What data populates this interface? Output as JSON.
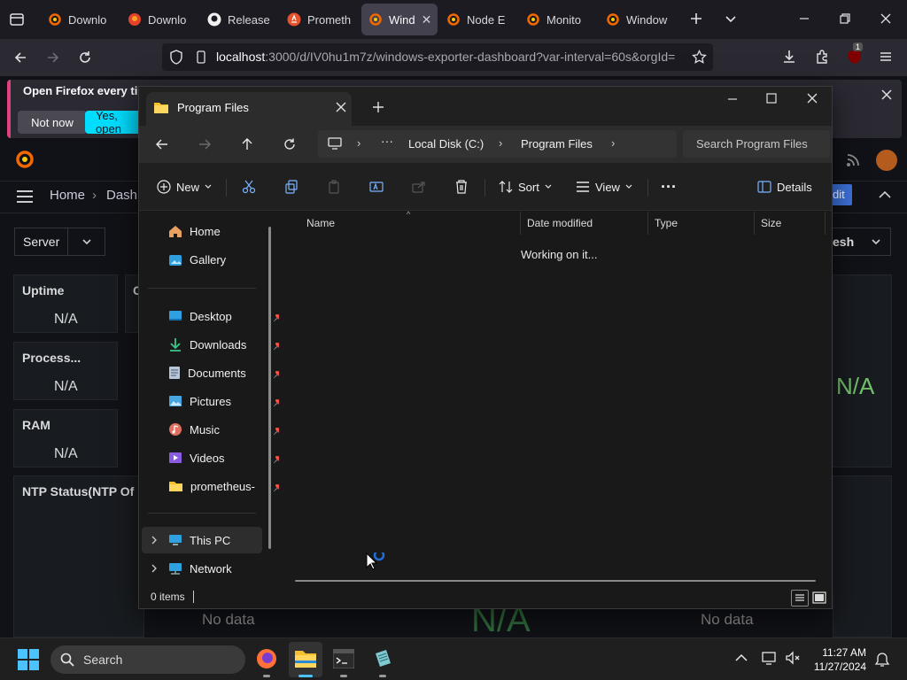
{
  "browser": {
    "tabs": [
      {
        "label": "Downlo",
        "icon": "grafana-icon",
        "active": false
      },
      {
        "label": "Downlo",
        "icon": "gitlab-icon",
        "active": false
      },
      {
        "label": "Release",
        "icon": "github-icon",
        "active": false
      },
      {
        "label": "Prometh",
        "icon": "prometheus-icon",
        "active": false
      },
      {
        "label": "Wind",
        "icon": "grafana-icon",
        "active": true
      },
      {
        "label": "Node E",
        "icon": "grafana-icon",
        "active": false
      },
      {
        "label": "Monito",
        "icon": "grafana-icon",
        "active": false
      },
      {
        "label": "Window",
        "icon": "grafana-icon",
        "active": false
      }
    ],
    "url_host": "localhost",
    "url_rest": ":3000/d/IV0hu1m7z/windows-exporter-dashboard?var-interval=60s&orgId=",
    "extension_badge": "1",
    "notification": {
      "text": "Open Firefox every time",
      "not_now": "Not now",
      "yes": "Yes, open"
    }
  },
  "grafana": {
    "breadcrumb_home": "Home",
    "breadcrumb_next": "Dashb",
    "server_label": "Server",
    "refresh_label": "esh",
    "edit_label": "dit",
    "panels": [
      {
        "title": "Uptime",
        "value": "N/A"
      },
      {
        "title": "Process...",
        "value": "N/A"
      },
      {
        "title": "RAM",
        "value": "N/A"
      }
    ],
    "cut_title": "C",
    "ntp_title": "NTP Status(NTP Of",
    "big_na": "N/A",
    "big_na2": "N/A",
    "nodata_left": "No data",
    "nodata_right": "No data"
  },
  "explorer": {
    "tab_title": "Program Files",
    "breadcrumb": [
      "Local Disk (C:)",
      "Program Files"
    ],
    "search_placeholder": "Search Program Files",
    "toolbar": {
      "new": "New",
      "sort": "Sort",
      "view": "View",
      "details": "Details"
    },
    "nav": {
      "quick": [
        "Home",
        "Gallery"
      ],
      "pinned": [
        "Desktop",
        "Downloads",
        "Documents",
        "Pictures",
        "Music",
        "Videos",
        "prometheus-"
      ],
      "tree": [
        "This PC",
        "Network"
      ]
    },
    "columns": [
      "Name",
      "Date modified",
      "Type",
      "Size"
    ],
    "loading_text": "Working on it...",
    "status_items": "0 items"
  },
  "taskbar": {
    "search_label": "Search",
    "time": "11:27 AM",
    "date": "11/27/2024"
  },
  "colors": {
    "accent": "#00b4d8",
    "firefox_dark": "#1c1b22",
    "grafana_green": "#73bf69",
    "explorer_bg": "#191919"
  }
}
